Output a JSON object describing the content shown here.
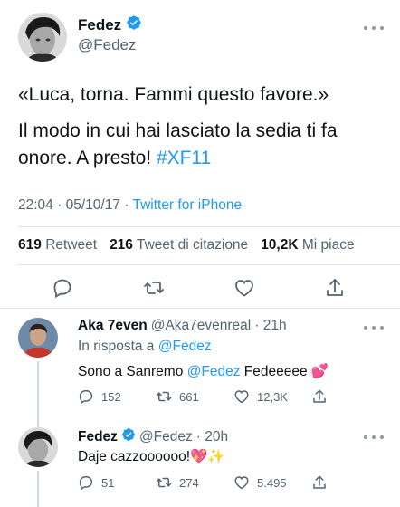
{
  "main_tweet": {
    "name": "Fedez",
    "handle": "@Fedez",
    "text_line1": "«Luca, torna. Fammi questo favore.»",
    "text_line2_prefix": "Il modo in cui hai lasciato la sedia ti fa onore. A presto! ",
    "hashtag": "#XF11",
    "time": "22:04",
    "date": "05/10/17",
    "meta_sep": "·",
    "source": "Twitter for iPhone",
    "retweets_count": "619",
    "retweets_label": "Retweet",
    "quotes_count": "216",
    "quotes_label": "Tweet di citazione",
    "likes_count": "10,2K",
    "likes_label": "Mi piace"
  },
  "replies": [
    {
      "name": "Aka 7even",
      "handle": "@Aka7evenreal",
      "time": "· 21h",
      "reply_prefix": "In risposta a",
      "reply_to": "@Fedez",
      "text_prefix": "Sono a Sanremo ",
      "mention": "@Fedez",
      "text_suffix": " Fedeeeee 💕",
      "replies_count": "152",
      "retweets_count": "661",
      "likes_count": "12,3K"
    },
    {
      "name": "Fedez",
      "handle": "@Fedez",
      "time": "· 20h",
      "text": "Daje cazzoooooo!💖✨",
      "replies_count": "51",
      "retweets_count": "274",
      "likes_count": "5.495"
    }
  ],
  "colors": {
    "accent": "#1d9bf0",
    "muted": "#536471",
    "text": "#0f1419"
  },
  "icons": [
    "verified-badge-icon",
    "more-icon",
    "reply-icon",
    "retweet-icon",
    "like-icon",
    "share-icon"
  ]
}
